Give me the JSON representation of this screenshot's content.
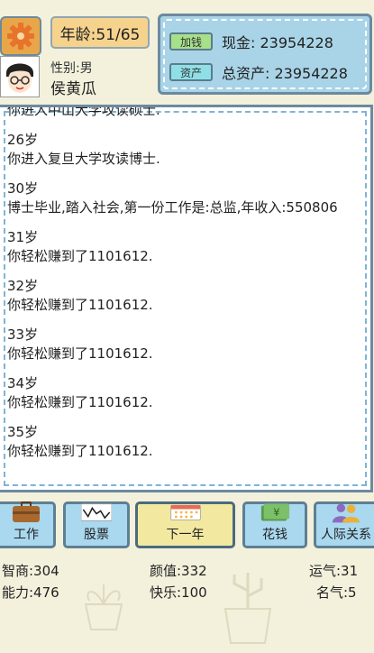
{
  "header": {
    "age_label": "年龄:51/65",
    "gender_label": "性别:男",
    "name": "侯黄瓜"
  },
  "money": {
    "add_money_button": "加钱",
    "cash_label": "现金: 23954228",
    "assets_button": "资产",
    "total_assets_label": "总资产: 23954228"
  },
  "log": {
    "entries": [
      {
        "age": "",
        "text": "你进入中山大学攻读硕士."
      },
      {
        "age": "26岁",
        "text": "你进入复旦大学攻读博士."
      },
      {
        "age": "30岁",
        "text": "博士毕业,踏入社会,第一份工作是:总监,年收入:550806"
      },
      {
        "age": "31岁",
        "text": "你轻松赚到了1101612."
      },
      {
        "age": "32岁",
        "text": "你轻松赚到了1101612."
      },
      {
        "age": "33岁",
        "text": "你轻松赚到了1101612."
      },
      {
        "age": "34岁",
        "text": "你轻松赚到了1101612."
      },
      {
        "age": "35岁",
        "text": "你轻松赚到了1101612."
      }
    ]
  },
  "actions": {
    "work": "工作",
    "stock": "股票",
    "next_year": "下一年",
    "spend": "花钱",
    "social": "人际关系"
  },
  "stats": {
    "iq": "智商:304",
    "looks": "颜值:332",
    "luck": "运气:31",
    "ability": "能力:476",
    "happiness": "快乐:100",
    "fame": "名气:5"
  },
  "colors": {
    "background": "#f3f0dc",
    "panel_blue": "#a9d4e8",
    "border": "#6b8aa0",
    "age_box": "#f6d38d",
    "next_button": "#f2e8a0"
  }
}
